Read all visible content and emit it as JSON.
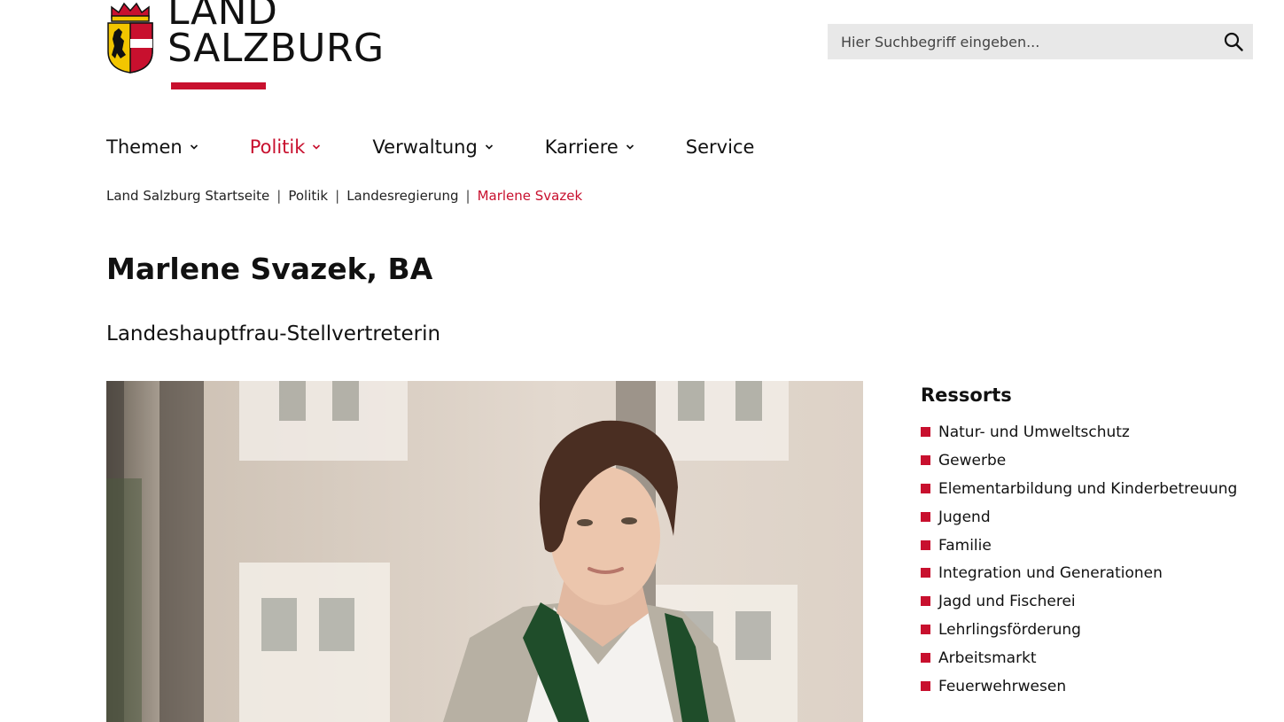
{
  "logo": {
    "line1": "LAND",
    "line2": "SALZBURG",
    "accent_color": "#c8102e"
  },
  "search": {
    "placeholder": "Hier Suchbegriff eingeben...",
    "icon": "search-icon"
  },
  "nav": {
    "items": [
      {
        "label": "Themen"
      },
      {
        "label": "Politik"
      },
      {
        "label": "Verwaltung"
      },
      {
        "label": "Karriere"
      },
      {
        "label": "Service"
      }
    ],
    "active_color": "#c8102e"
  },
  "breadcrumb": {
    "items": [
      "Land Salzburg Startseite",
      "Politik",
      "Landesregierung",
      "Marlene Svazek"
    ],
    "separator": "|"
  },
  "page": {
    "title": "Marlene Svazek, BA",
    "subtitle": "Landeshauptfrau-Stellvertreterin"
  },
  "ressorts": {
    "heading": "Ressorts",
    "items": [
      "Natur- und Umweltschutz",
      "Gewerbe",
      "Elementarbildung und Kinderbetreuung",
      "Jugend",
      "Familie",
      "Integration und Generationen",
      "Jagd und Fischerei",
      "Lehrlingsförderung",
      "Arbeitsmarkt",
      "Feuerwehrwesen"
    ]
  }
}
